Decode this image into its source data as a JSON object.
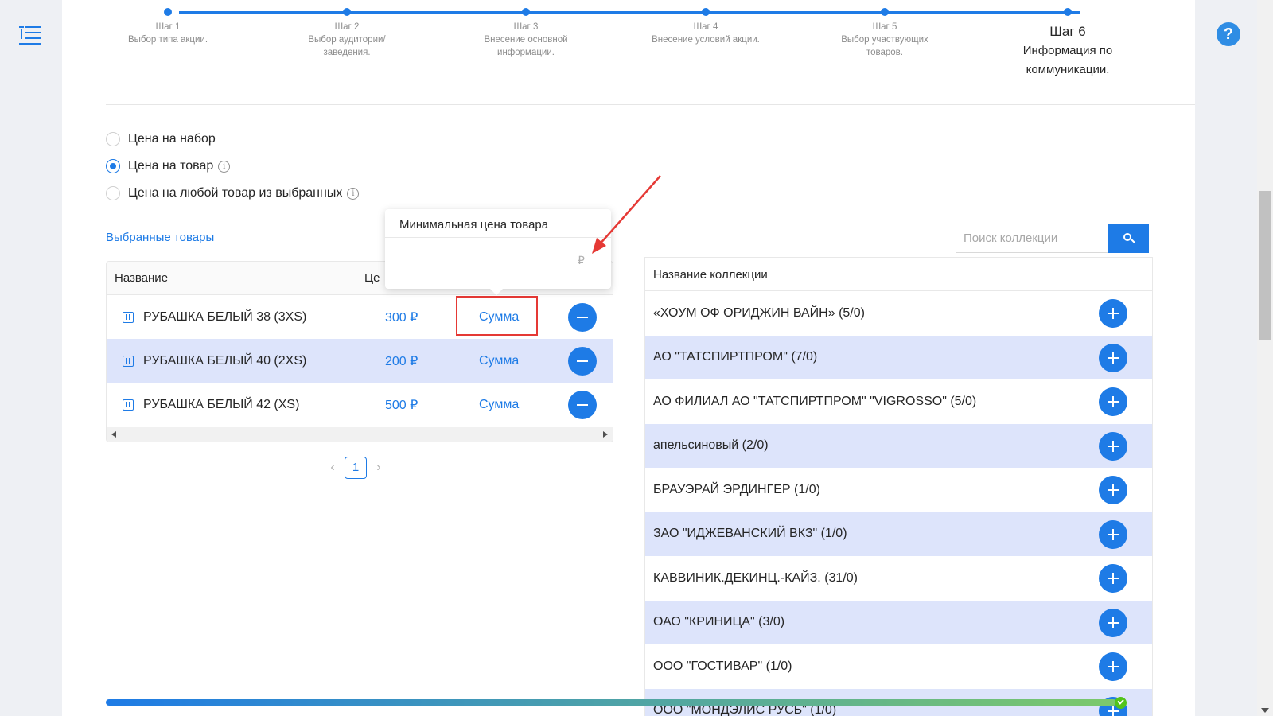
{
  "stepper": {
    "steps": [
      {
        "title": "Шаг 1",
        "desc": "Выбор типа акции."
      },
      {
        "title": "Шаг 2",
        "desc": "Выбор аудитории/заведения."
      },
      {
        "title": "Шаг 3",
        "desc": "Внесение основной информации."
      },
      {
        "title": "Шаг 4",
        "desc": "Внесение условий акции."
      },
      {
        "title": "Шаг 5",
        "desc": "Выбор участвующих товаров."
      },
      {
        "title": "Шаг 6",
        "desc": "Информация по коммуникации."
      }
    ]
  },
  "price_options": [
    {
      "label": "Цена на набор",
      "checked": false
    },
    {
      "label": "Цена на товар",
      "checked": true
    },
    {
      "label": "Цена на любой товар из выбранных",
      "checked": false
    }
  ],
  "selected_goods": {
    "title": "Выбранные товары",
    "headers": {
      "name": "Название",
      "price": "Це"
    },
    "rows": [
      {
        "name": "РУБАШКА БЕЛЫЙ 38 (3XS)",
        "price": "300 ₽",
        "sum": "Сумма"
      },
      {
        "name": "РУБАШКА БЕЛЫЙ 40 (2XS)",
        "price": "200 ₽",
        "sum": "Сумма"
      },
      {
        "name": "РУБАШКА БЕЛЫЙ 42 (XS)",
        "price": "500 ₽",
        "sum": "Сумма"
      }
    ]
  },
  "pagination": {
    "prev": "‹",
    "page": "1",
    "next": "›"
  },
  "popover": {
    "title": "Минимальная цена товара",
    "value": "",
    "currency": "₽"
  },
  "collections": {
    "search_placeholder": "Поиск коллекции",
    "header": "Название коллекции",
    "rows": [
      "«ХОУМ ОФ ОРИДЖИН ВАЙН» (5/0)",
      "АО \"ТАТСПИРТПРОМ\" (7/0)",
      "АО ФИЛИАЛ АО \"ТАТСПИРТПРОМ\" \"VIGROSSO\" (5/0)",
      "апельсиновый (2/0)",
      "БРАУЭРАЙ ЭРДИНГЕР (1/0)",
      "ЗАО \"ИДЖЕВАНСКИЙ ВКЗ\" (1/0)",
      "КАВВИНИК.ДЕКИНЦ.-КАЙЗ. (31/0)",
      "ОАО \"КРИНИЦА\" (3/0)",
      "ООО \"ГОСТИВАР\" (1/0)",
      "ООО \"МОНДЭЛИС РУСЬ\" (1/0)"
    ]
  },
  "progress": {
    "value": 1.0
  },
  "help": {
    "label": "?"
  },
  "colors": {
    "accent": "#1e7be6",
    "row_highlight": "#dde4fb",
    "annotation": "#e53935"
  }
}
